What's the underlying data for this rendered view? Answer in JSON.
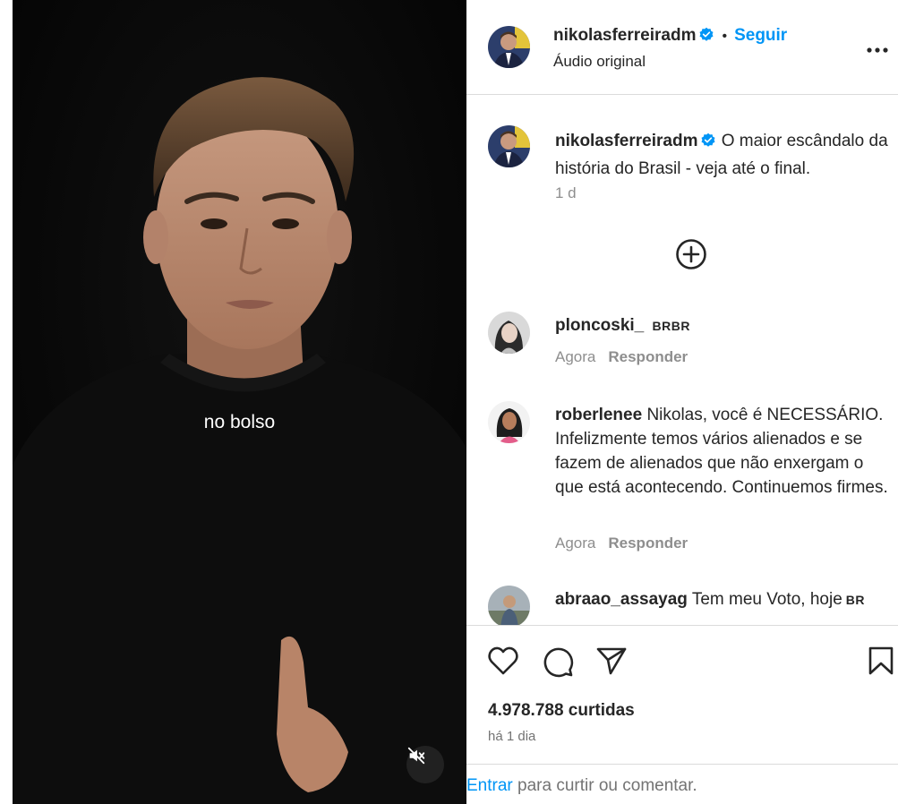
{
  "video": {
    "subtitle": "no bolso",
    "mute_icon": "speaker-muted-icon"
  },
  "header": {
    "username": "nikolasferreiradm",
    "verified_icon": "verified-badge-icon",
    "separator": "•",
    "follow_label": "Seguir",
    "audio_label": "Áudio original",
    "more_icon": "more-options-icon"
  },
  "caption": {
    "username": "nikolasferreiradm",
    "text": "O maior escândalo da história do Brasil - veja até o final.",
    "time": "1 d",
    "load_more_icon": "plus-circle-icon"
  },
  "comments": [
    {
      "username": "ploncoski_",
      "text": "",
      "tag": "BRBR",
      "time": "Agora",
      "reply_label": "Responder"
    },
    {
      "username": "roberlenee",
      "text": "Nikolas, você é NECESSÁRIO. Infelizmente temos vários alienados e se fazem de alienados que não enxergam o que está acontecendo. Continuemos firmes.",
      "tag": "",
      "time": "Agora",
      "reply_label": "Responder"
    },
    {
      "username": "abraao_assayag",
      "text": "Tem meu Voto, hoje",
      "tag": "BR",
      "time": "",
      "reply_label": ""
    }
  ],
  "actions": {
    "like_icon": "heart-icon",
    "comment_icon": "comment-bubble-icon",
    "share_icon": "paper-plane-icon",
    "save_icon": "bookmark-icon",
    "likes_text": "4.978.788 curtidas",
    "posted_ago": "há 1 dia"
  },
  "login_bar": {
    "login_link": "Entrar",
    "rest": " para curtir ou comentar."
  },
  "colors": {
    "link_blue": "#0095f6",
    "muted_gray": "#8e8e8e",
    "text_dark": "#262626",
    "divider": "#dbdbdb"
  }
}
